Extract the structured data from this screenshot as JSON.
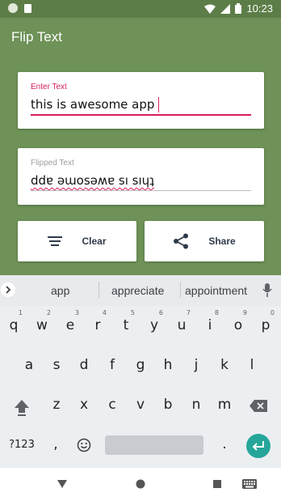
{
  "status_bar": {
    "time": "10:23",
    "icons": [
      "circle-icon",
      "sd-card-icon",
      "wifi-icon",
      "signal-icon",
      "battery-icon"
    ]
  },
  "app_bar": {
    "title": "Flip Text"
  },
  "input_card": {
    "label": "Enter Text",
    "value": "this is awesome app"
  },
  "output_card": {
    "label": "Flipped Text",
    "value": "ddɐ ǝɯosǝʍɐ sı sıɥʇ"
  },
  "buttons": {
    "clear": "Clear",
    "share": "Share"
  },
  "keyboard": {
    "suggestions": [
      "app",
      "appreciate",
      "appointment"
    ],
    "row1": [
      "q",
      "w",
      "e",
      "r",
      "t",
      "y",
      "u",
      "i",
      "o",
      "p"
    ],
    "row1_hints": [
      "1",
      "2",
      "3",
      "4",
      "5",
      "6",
      "7",
      "8",
      "9",
      "0"
    ],
    "row2": [
      "a",
      "s",
      "d",
      "f",
      "g",
      "h",
      "j",
      "k",
      "l"
    ],
    "row3": [
      "z",
      "x",
      "c",
      "v",
      "b",
      "n",
      "m"
    ],
    "symbols_key": "?123",
    "comma": ",",
    "period": "."
  },
  "colors": {
    "app_background": "#6e9257",
    "accent": "#d81b60",
    "enter_key": "#26a69a"
  }
}
